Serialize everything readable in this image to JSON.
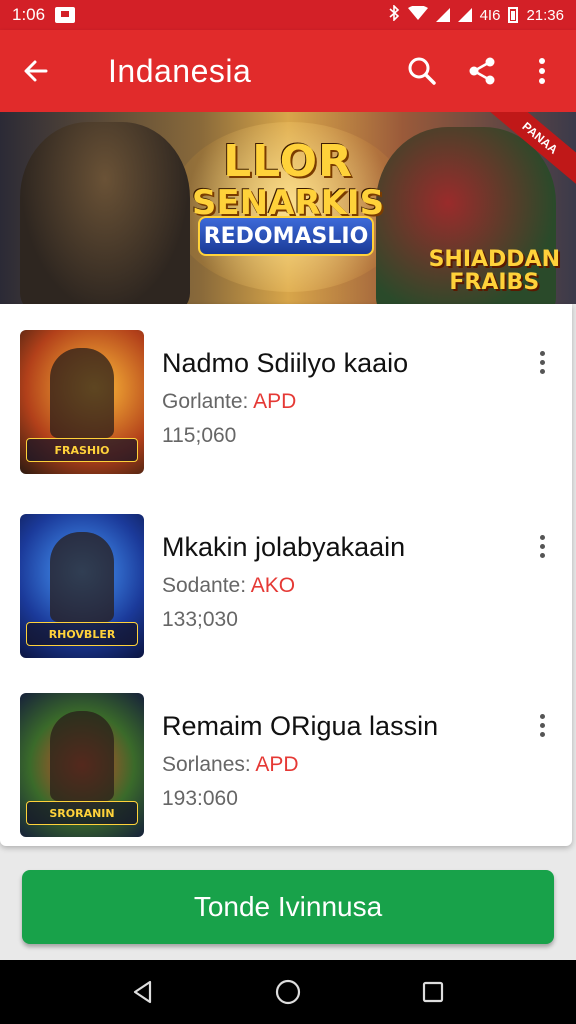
{
  "status_bar": {
    "time_left": "1:06",
    "network_text": "4I6",
    "time_right": "21:36"
  },
  "app_bar": {
    "title": "Indanesia",
    "icons": [
      "back-arrow-icon",
      "search-icon",
      "share-icon",
      "more-vert-icon"
    ]
  },
  "banner": {
    "logo_line1": "LLOR",
    "logo_line2": "SENARKIS",
    "logo_ribbon": "REDOMASLIO",
    "side_text_1": "SHIADDAN",
    "side_text_2": "FRAIBS",
    "corner_tag": "PANAA"
  },
  "list": {
    "items": [
      {
        "title": "Nadmo Sdiilyo kaaio",
        "sub_label": "Gorlante:",
        "sub_value": "APD",
        "count": "115;060",
        "thumb_label": "FRASHIO"
      },
      {
        "title": "Mkakin jolabyakaain",
        "sub_label": "Sodante:",
        "sub_value": "AKO",
        "count": "133;030",
        "thumb_label": "RHOVBLER"
      },
      {
        "title": "Remaim ORigua lassin",
        "sub_label": "Sorlanes:",
        "sub_value": "APD",
        "count": "193:060",
        "thumb_label": "SRORANIN"
      }
    ]
  },
  "cta": {
    "label": "Tonde Ivinnusa"
  },
  "colors": {
    "app_bar": "#e12b2b",
    "status_bar": "#d32027",
    "cta": "#18a24a",
    "price": "#e53935"
  }
}
